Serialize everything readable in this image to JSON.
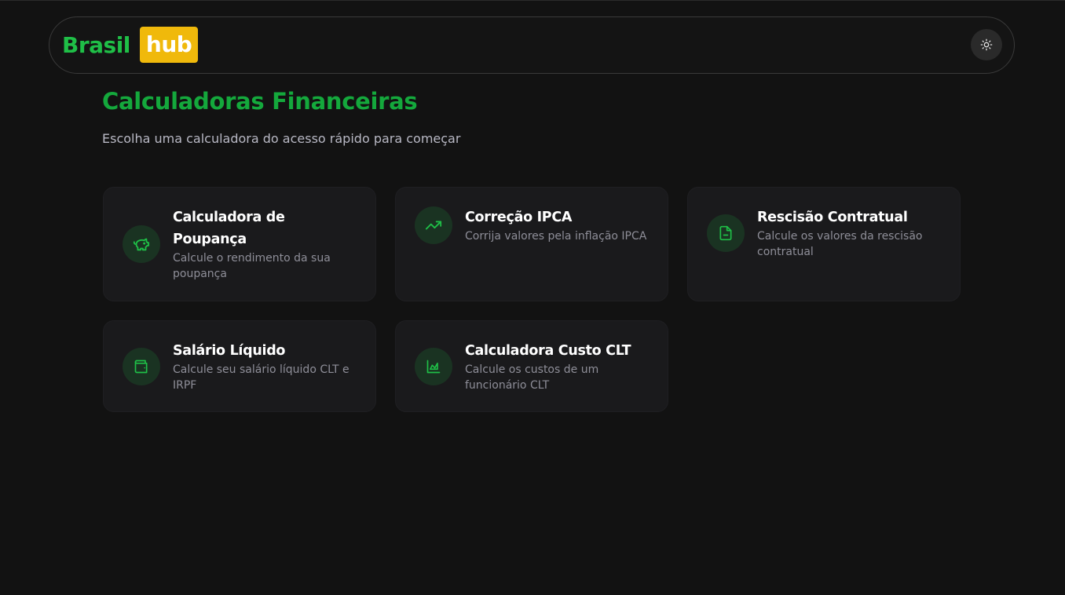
{
  "header": {
    "logo_brasil": "Brasil",
    "logo_hub": "hub",
    "theme_toggle_icon": "sun-icon"
  },
  "main": {
    "title": "Calculadoras Financeiras",
    "subtitle": "Escolha uma calculadora do acesso rápido para começar"
  },
  "cards": [
    {
      "title": "Calculadora de Poupança",
      "desc": "Calcule o rendimento da sua poupança",
      "icon": "piggy-bank-icon"
    },
    {
      "title": "Correção IPCA",
      "desc": "Corrija valores pela inflação IPCA",
      "icon": "trending-up-icon"
    },
    {
      "title": "Rescisão Contratual",
      "desc": "Calcule os valores da rescisão contratual",
      "icon": "file-icon"
    },
    {
      "title": "Salário Líquido",
      "desc": "Calcule seu salário líquido CLT e IRPF",
      "icon": "wallet-icon"
    },
    {
      "title": "Calculadora Custo CLT",
      "desc": "Calcule os custos de um funcionário CLT",
      "icon": "area-chart-icon"
    }
  ],
  "colors": {
    "background": "#121212",
    "brand_green": "#1fbf47",
    "title_green": "#14a83c",
    "brand_yellow": "#f0b90b",
    "card_bg": "#1a1a1c",
    "icon_bg": "#1a3322"
  }
}
